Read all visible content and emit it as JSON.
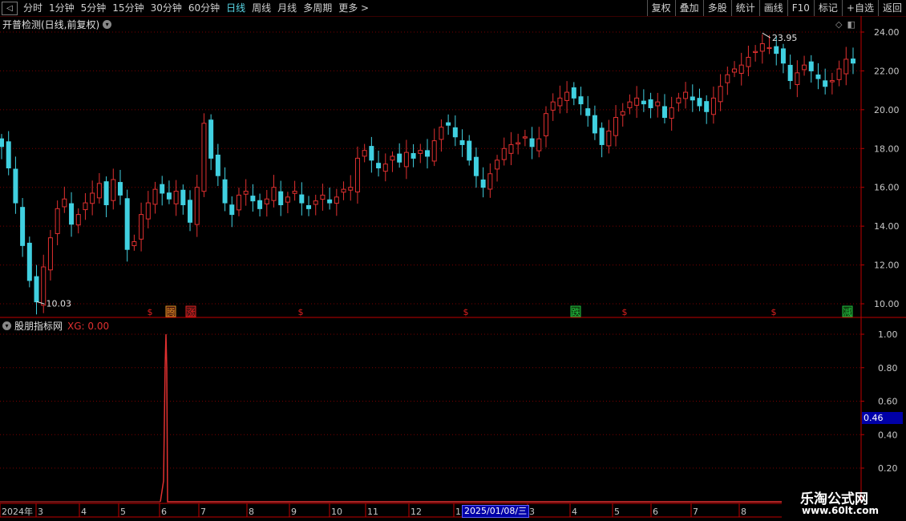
{
  "toolbar": {
    "back_icon": "back-arrow-icon",
    "periods": [
      "分时",
      "1分钟",
      "5分钟",
      "15分钟",
      "30分钟",
      "60分钟",
      "日线",
      "周线",
      "月线",
      "多周期",
      "更多 >"
    ],
    "active_period": "日线",
    "right_buttons": [
      "复权",
      "叠加",
      "多股",
      "统计",
      "画线",
      "F10",
      "标记",
      "+自选",
      "返回"
    ]
  },
  "main_panel": {
    "indicator_title": "开普检测(日线,前复权)",
    "price_ticks": [
      "24.00",
      "22.00",
      "20.00",
      "18.00",
      "16.00",
      "14.00",
      "12.00",
      "10.00"
    ],
    "high_label": "23.95",
    "low_label": "10.03",
    "signals": [
      {
        "label": "$",
        "color": "#e02020"
      },
      {
        "label": "腾",
        "color": "#e09020"
      },
      {
        "label": "涨",
        "color": "#e02020"
      },
      {
        "label": "$",
        "color": "#e02020"
      },
      {
        "label": "$",
        "color": "#e02020"
      },
      {
        "label": "跌",
        "color": "#20c040"
      },
      {
        "label": "$",
        "color": "#e02020"
      },
      {
        "label": "$",
        "color": "#e02020"
      },
      {
        "label": "减",
        "color": "#20c040"
      }
    ]
  },
  "sub_panel": {
    "name": "股朋指标网",
    "xg_text": "XG: 0.00",
    "ticks": [
      "1.00",
      "0.80",
      "0.60",
      "0.40",
      "0.20"
    ],
    "current_value": "0.46"
  },
  "time_axis": {
    "labels": [
      "2024年",
      "3",
      "4",
      "5",
      "6",
      "7",
      "8",
      "9",
      "10",
      "11",
      "12",
      "1",
      "3",
      "4",
      "5",
      "6",
      "7",
      "8"
    ],
    "selected_date": "2025/01/08/三"
  },
  "watermark": {
    "line1": "乐淘公式网",
    "line2": "www.60lt.com"
  },
  "colors": {
    "up": "#e03030",
    "down": "#40d0e0",
    "grid": "#7a0000",
    "axis": "#c00000"
  },
  "chart_data": {
    "type": "candlestick",
    "price_range": [
      10.0,
      24.0
    ],
    "high": 23.95,
    "low": 10.03,
    "close_trend": [
      18.1,
      17.0,
      15.2,
      13.0,
      11.2,
      10.1,
      11.9,
      13.4,
      14.9,
      15.4,
      14.1,
      14.6,
      15.2,
      15.7,
      16.2,
      15.1,
      16.4,
      15.6,
      12.8,
      13.2,
      14.6,
      15.2,
      15.9,
      15.7,
      15.4,
      15.8,
      15.1,
      14.2,
      16.0,
      19.3,
      17.5,
      16.6,
      15.2,
      14.6,
      15.6,
      15.8,
      15.3,
      14.9,
      15.4,
      16.0,
      15.1,
      15.5,
      15.8,
      15.2,
      14.9,
      15.3,
      15.6,
      15.2,
      15.5,
      15.9,
      16.0,
      17.5,
      17.9,
      17.4,
      17.0,
      17.2,
      17.6,
      17.3,
      17.8,
      17.5,
      17.9,
      17.6,
      18.4,
      19.1,
      19.2,
      18.6,
      18.2,
      17.4,
      16.6,
      16.0,
      16.7,
      17.4,
      18.0,
      18.2,
      18.3,
      18.6,
      18.1,
      18.5,
      19.8,
      20.4,
      20.6,
      20.9,
      20.6,
      20.3,
      19.7,
      18.8,
      18.2,
      18.9,
      19.6,
      19.9,
      20.4,
      20.6,
      20.3,
      20.1,
      20.4,
      19.6,
      20.1,
      20.6,
      20.9,
      20.5,
      20.2,
      19.9,
      20.6,
      21.2,
      21.8,
      22.1,
      22.3,
      22.7,
      23.0,
      23.4,
      23.2,
      22.9,
      22.4,
      21.5,
      21.9,
      22.3,
      22.0,
      21.6,
      21.2,
      21.5,
      22.1,
      22.6,
      22.4
    ]
  }
}
